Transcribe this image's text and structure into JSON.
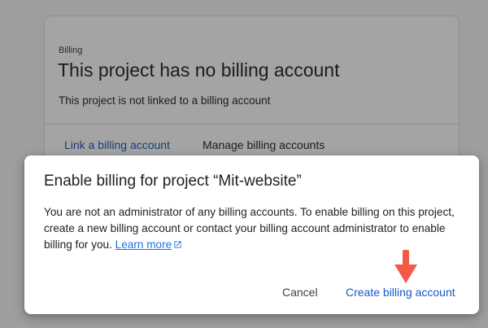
{
  "card": {
    "eyebrow": "Billing",
    "title": "This project has no billing account",
    "description": "This project is not linked to a billing account",
    "link_billing_label": "Link a billing account",
    "manage_billing_label": "Manage billing accounts"
  },
  "dialog": {
    "title": "Enable billing for project “Mit-website”",
    "body": "You are not an administrator of any billing accounts. To enable billing on this project, create a new billing account or contact your billing account administrator to enable billing for you.",
    "learn_more_label": "Learn more",
    "cancel_label": "Cancel",
    "create_label": "Create billing account"
  },
  "icons": {
    "external_link": "open-in-new-icon",
    "pointer": "arrow-down-icon"
  },
  "colors": {
    "overlay": "#9e9e9e",
    "link": "#1a73e8",
    "primary_button": "#1a56c9",
    "arrow": "#f05a47"
  }
}
